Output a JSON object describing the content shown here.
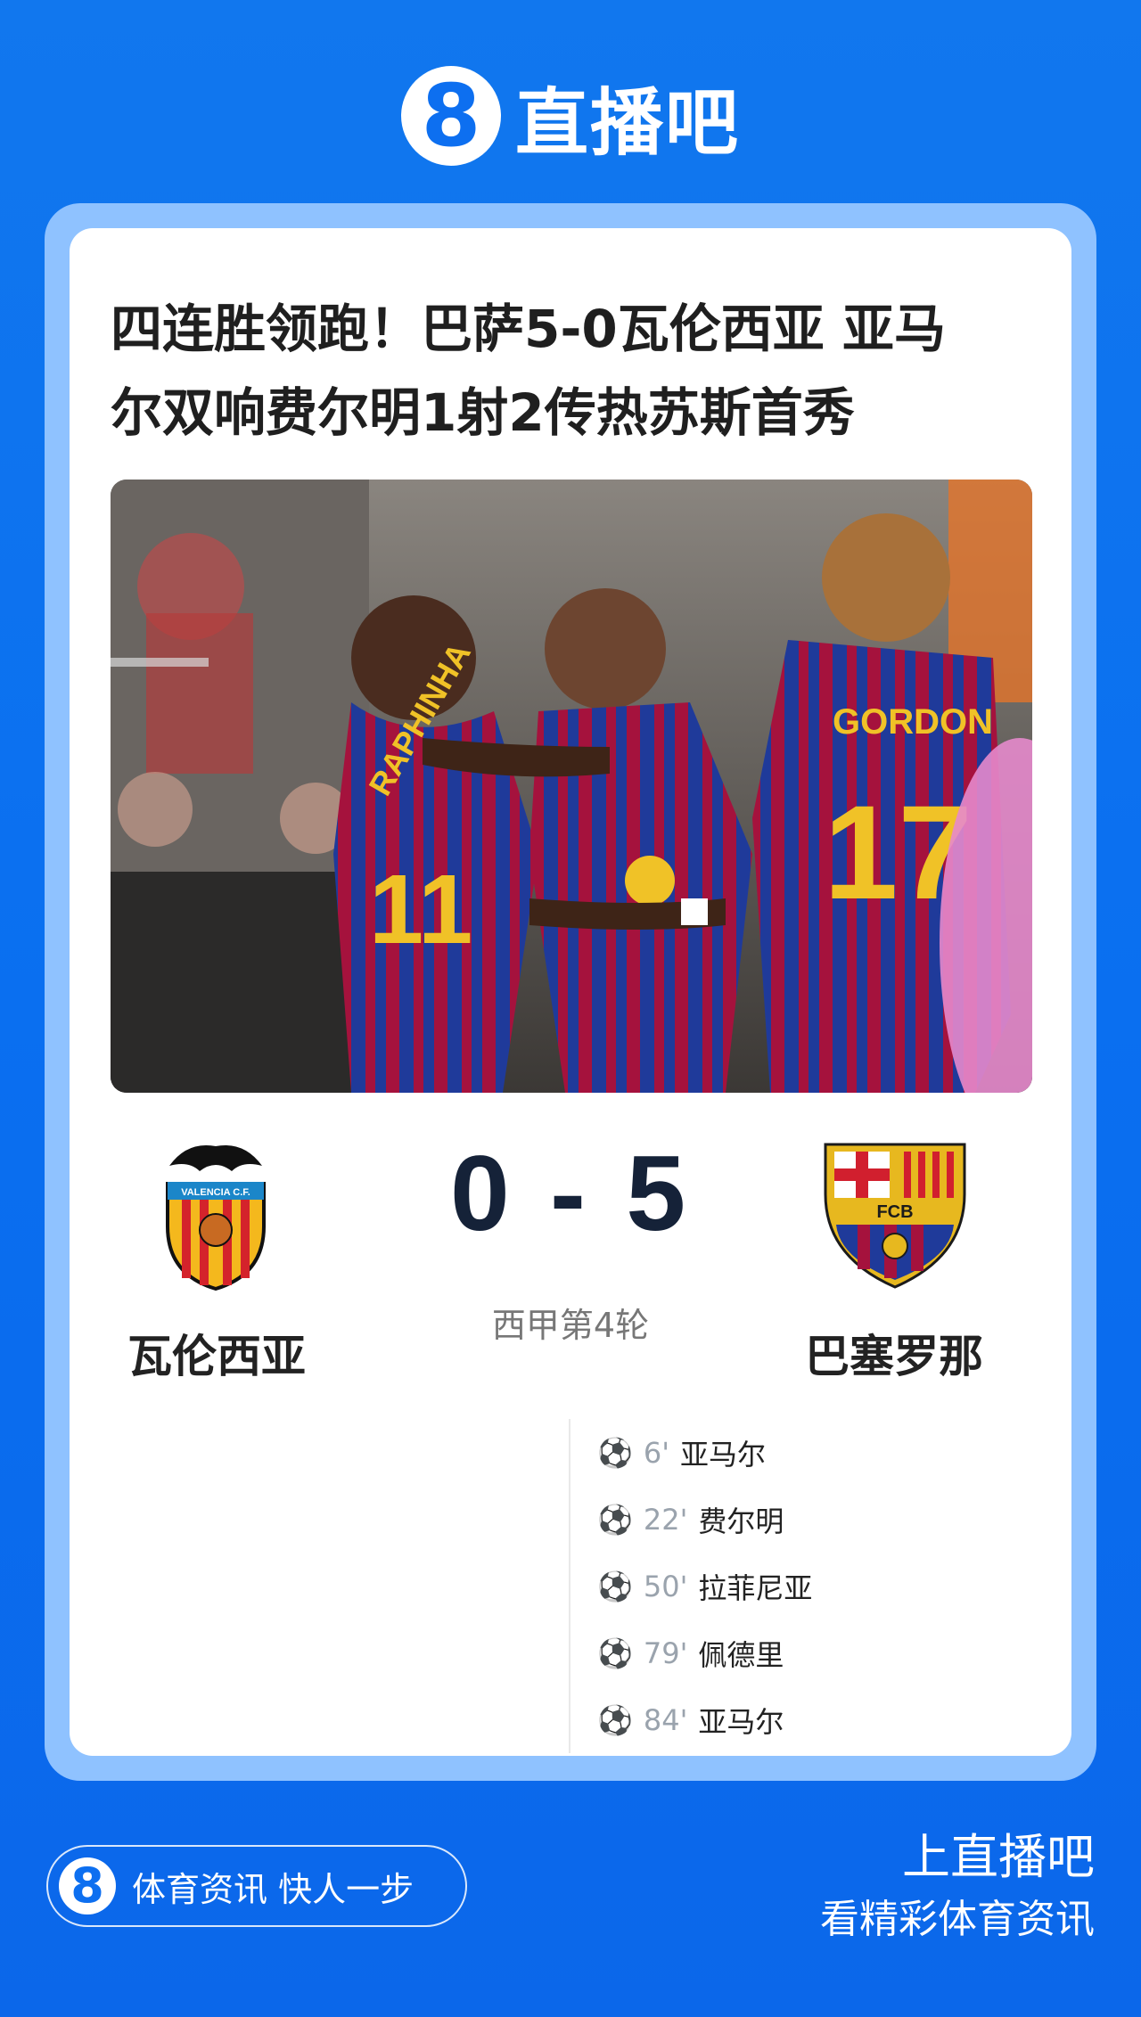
{
  "brand": {
    "badge": "8",
    "name": "直播吧"
  },
  "article": {
    "headline_line1": "四连胜领跑！巴萨5-0瓦伦西亚 亚马",
    "headline_line2": "尔双响费尔明1射2传热苏斯首秀"
  },
  "match": {
    "home_team": "瓦伦西亚",
    "away_team": "巴塞罗那",
    "score": "0 - 5",
    "competition_round": "西甲第4轮",
    "home_crest_text": "VALENCIA C.F.",
    "away_crest_text": "FCB"
  },
  "goals": [
    {
      "minute": "6'",
      "player": "亚马尔"
    },
    {
      "minute": "22'",
      "player": "费尔明"
    },
    {
      "minute": "50'",
      "player": "拉菲尼亚"
    },
    {
      "minute": "79'",
      "player": "佩德里"
    },
    {
      "minute": "84'",
      "player": "亚马尔"
    }
  ],
  "photo": {
    "jersey_name_1": "RAPHINHA",
    "jersey_number_1": "11",
    "jersey_name_2": "GORDON",
    "jersey_number_2": "17"
  },
  "footer": {
    "badge": "8",
    "slogan": "体育资讯 快人一步",
    "cta_line1": "上直播吧",
    "cta_line2": "看精彩体育资讯"
  },
  "colors": {
    "background": "#0d6ff0",
    "card_frame": "#8fc2ff",
    "score": "#152238"
  }
}
